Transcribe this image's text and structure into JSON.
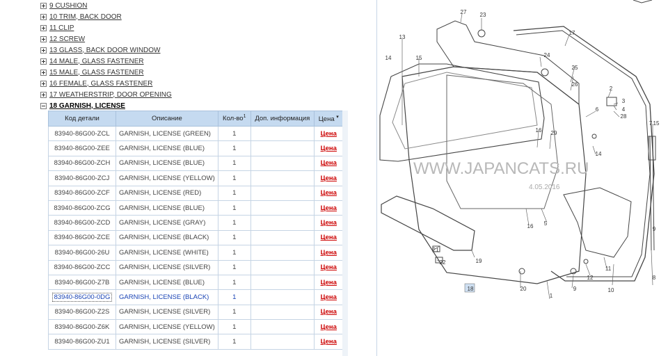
{
  "tree": [
    {
      "label": "9 CUSHION",
      "open": false
    },
    {
      "label": "10 TRIM, BACK DOOR",
      "open": false
    },
    {
      "label": "11  CLIP",
      "open": false
    },
    {
      "label": "12 SCREW",
      "open": false
    },
    {
      "label": "13 GLASS, BACK DOOR WINDOW",
      "open": false
    },
    {
      "label": "14  MALE, GLASS FASTENER",
      "open": false
    },
    {
      "label": "15  MALE, GLASS FASTENER",
      "open": false
    },
    {
      "label": "16 FEMALE, GLASS FASTENER",
      "open": false
    },
    {
      "label": "17 WEATHERSTRIP, DOOR OPENING",
      "open": false
    },
    {
      "label": "18 GARNISH, LICENSE",
      "open": true
    }
  ],
  "table": {
    "headers": {
      "code": "Код детали",
      "desc": "Описание",
      "qty": "Кол-во",
      "info": "Доп. информация",
      "price": "Цена"
    },
    "sort_mark": "1",
    "price_link": "Цена",
    "rows": [
      {
        "code": "83940-86G00-ZCL",
        "desc": "GARNISH, LICENSE (GREEN)",
        "qty": "1"
      },
      {
        "code": "83940-86G00-ZEE",
        "desc": "GARNISH, LICENSE (BLUE)",
        "qty": "1"
      },
      {
        "code": "83940-86G00-ZCH",
        "desc": "GARNISH, LICENSE (BLUE)",
        "qty": "1"
      },
      {
        "code": "83940-86G00-ZCJ",
        "desc": "GARNISH, LICENSE (YELLOW)",
        "qty": "1"
      },
      {
        "code": "83940-86G00-ZCF",
        "desc": "GARNISH, LICENSE (RED)",
        "qty": "1"
      },
      {
        "code": "83940-86G00-ZCG",
        "desc": "GARNISH, LICENSE (BLUE)",
        "qty": "1"
      },
      {
        "code": "83940-86G00-ZCD",
        "desc": "GARNISH, LICENSE (GRAY)",
        "qty": "1"
      },
      {
        "code": "83940-86G00-ZCE",
        "desc": "GARNISH, LICENSE (BLACK)",
        "qty": "1"
      },
      {
        "code": "83940-86G00-26U",
        "desc": "GARNISH, LICENSE (WHITE)",
        "qty": "1"
      },
      {
        "code": "83940-86G00-ZCC",
        "desc": "GARNISH, LICENSE (SILVER)",
        "qty": "1"
      },
      {
        "code": "83940-86G00-Z7B",
        "desc": "GARNISH, LICENSE (BLUE)",
        "qty": "1"
      },
      {
        "code": "83940-86G00-0DG",
        "desc": "GARNISH, LICENSE (BLACK)",
        "qty": "1",
        "selected": true
      },
      {
        "code": "83940-86G00-Z2S",
        "desc": "GARNISH, LICENSE (SILVER)",
        "qty": "1"
      },
      {
        "code": "83940-86G00-Z6K",
        "desc": "GARNISH, LICENSE (YELLOW)",
        "qty": "1"
      },
      {
        "code": "83940-86G00-ZU1",
        "desc": "GARNISH, LICENSE (SILVER)",
        "qty": "1"
      }
    ]
  },
  "diagram": {
    "watermark": "WWW.JAPANCATS.RU",
    "date": "4.05.2016",
    "callouts": [
      "27",
      "23",
      "17",
      "13",
      "14",
      "15",
      "24",
      "25",
      "26",
      "2",
      "3",
      "4",
      "28",
      "6",
      "7",
      "15",
      "16",
      "29",
      "14",
      "16",
      "5",
      "9",
      "21",
      "22",
      "19",
      "18",
      "20",
      "1",
      "9",
      "12",
      "11",
      "10",
      "8"
    ],
    "highlighted": "18"
  }
}
